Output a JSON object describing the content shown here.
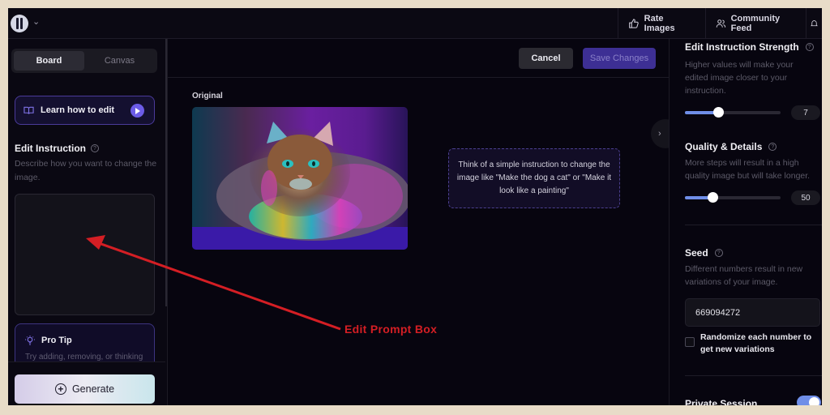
{
  "topbar": {
    "logo_icon": "app-logo",
    "nav": [
      {
        "label": "Rate Images",
        "icon": "thumbs-up-icon"
      },
      {
        "label": "Community Feed",
        "icon": "users-icon"
      },
      {
        "label": "",
        "icon": "bell-icon"
      }
    ]
  },
  "sidebar": {
    "tabs": [
      {
        "label": "Board",
        "active": true
      },
      {
        "label": "Canvas",
        "active": false
      }
    ],
    "learn_button": "Learn how to edit",
    "edit_instruction": {
      "title": "Edit Instruction",
      "description": "Describe how you want to change the image.",
      "value": "",
      "placeholder": ""
    },
    "pro_tip": {
      "title": "Pro Tip",
      "text": "Try adding, removing, or thinking"
    },
    "generate_button": "Generate"
  },
  "main": {
    "cancel_button": "Cancel",
    "save_button": "Save Changes",
    "original_label": "Original",
    "image_alt": "Fluffy cat with rainbow-colored fur on purple background",
    "hint_text": "Think of a simple instruction to change the image like \"Make the dog a cat\" or \"Make it look like a painting\""
  },
  "right_panel": {
    "strength": {
      "title": "Edit Instruction Strength",
      "description": "Higher values will make your edited image closer to your instruction.",
      "value": "7",
      "slider_fraction": 0.35
    },
    "quality": {
      "title": "Quality & Details",
      "description": "More steps will result in a high quality image but will take longer.",
      "value": "50",
      "slider_fraction": 0.29
    },
    "seed": {
      "title": "Seed",
      "description": "Different numbers result in new variations of your image.",
      "value": "669094272"
    },
    "randomize": {
      "label": "Randomize each number to get new variations",
      "checked": false
    },
    "private_session": {
      "label": "Private Session",
      "enabled": true
    }
  },
  "annotation": {
    "label": "Edit Prompt Box",
    "color": "#d41e24"
  },
  "colors": {
    "accent": "#6c5ce7",
    "slider": "#6f8ee8",
    "background": "#07050f",
    "frame": "#e8dcc8"
  }
}
